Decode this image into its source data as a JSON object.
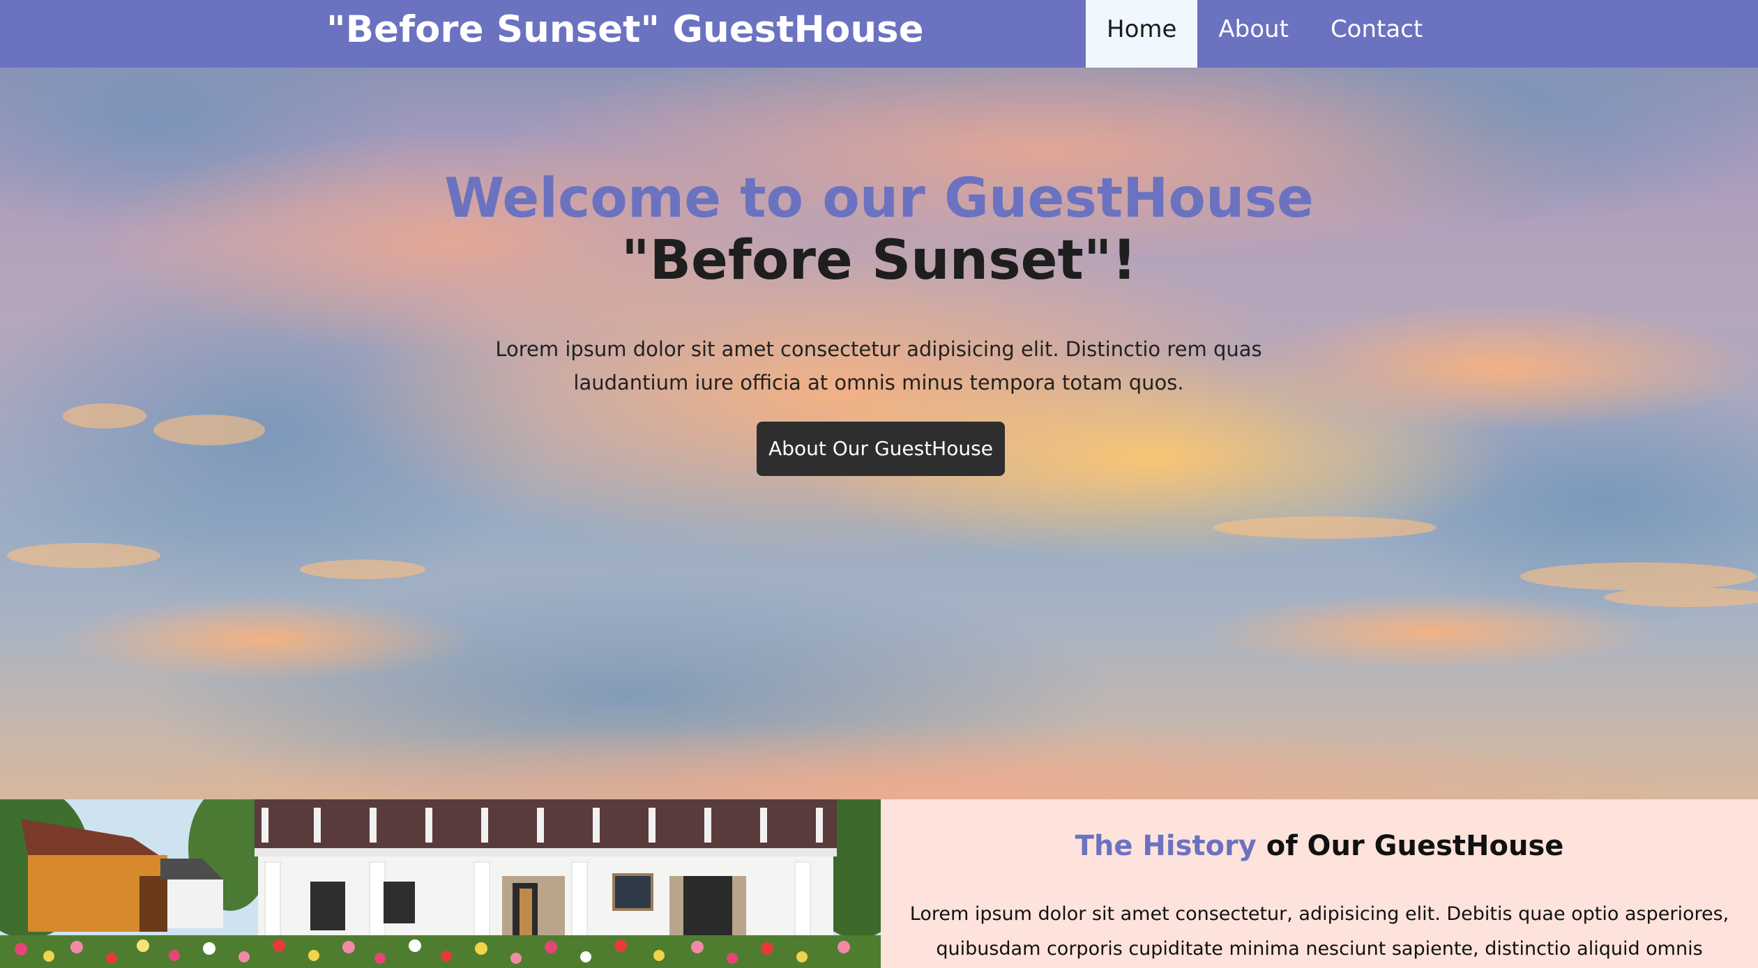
{
  "navbar": {
    "brand": "\"Before Sunset\" GuestHouse",
    "links": [
      {
        "label": "Home",
        "active": true
      },
      {
        "label": "About",
        "active": false
      },
      {
        "label": "Contact",
        "active": false
      }
    ]
  },
  "hero": {
    "title_line1": "Welcome to our GuestHouse",
    "title_line2": "\"Before Sunset\"!",
    "text": "Lorem ipsum dolor sit amet consectetur adipisicing elit. Distinctio rem quas laudantium iure officia at omnis minus tempora totam quos.",
    "button_label": "About Our GuestHouse"
  },
  "history": {
    "heading_accent": "The History",
    "heading_rest": " of Our GuestHouse",
    "text": "Lorem ipsum dolor sit amet consectetur, adipisicing elit. Debitis quae optio asperiores, quibusdam corporis cupiditate minima nesciunt sapiente, distinctio aliquid omnis"
  },
  "colors": {
    "accent": "#6b72c0",
    "navbar_bg": "#6b72c0",
    "active_tab_bg": "#f0f7ff",
    "button_bg": "#2e2e2e",
    "history_bg": "#fde3dc"
  }
}
